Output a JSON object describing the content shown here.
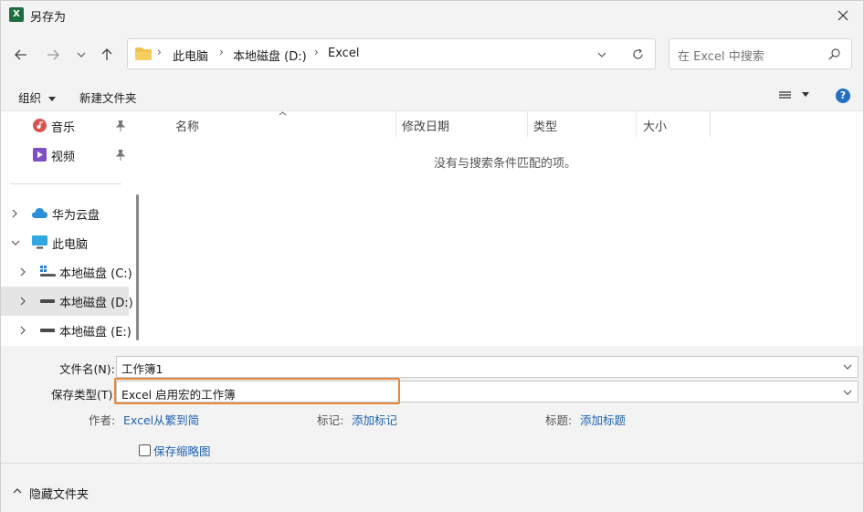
{
  "window": {
    "title": "另存为",
    "app_icon_letter": "X"
  },
  "nav": {
    "breadcrumb": [
      "此电脑",
      "本地磁盘 (D:)",
      "Excel"
    ],
    "search_placeholder": "在 Excel 中搜索"
  },
  "toolbar": {
    "organize": "组织",
    "new_folder": "新建文件夹",
    "help": "?"
  },
  "sidebar": {
    "items": [
      {
        "label": "音乐"
      },
      {
        "label": "视频"
      },
      {
        "label": "华为云盘"
      },
      {
        "label": "此电脑"
      },
      {
        "label": "本地磁盘 (C:)"
      },
      {
        "label": "本地磁盘 (D:)"
      },
      {
        "label": "本地磁盘 (E:)"
      }
    ]
  },
  "filelist": {
    "columns": [
      "名称",
      "修改日期",
      "类型",
      "大小"
    ],
    "empty_message": "没有与搜索条件匹配的项。"
  },
  "form": {
    "filename_label": "文件名(N):",
    "filename_value": "工作簿1",
    "filetype_label": "保存类型(T):",
    "filetype_value": "Excel 启用宏的工作簿",
    "author_label": "作者:",
    "author_value": "Excel从繁到简",
    "tags_label": "标记:",
    "tags_value": "添加标记",
    "title_label": "标题:",
    "title_value": "添加标题",
    "thumbnail_label": "保存缩略图"
  },
  "footer": {
    "hide_folders": "隐藏文件夹"
  },
  "colors": {
    "accent_link": "#1f63b0",
    "focus_ring": "#e6883a",
    "excel_green": "#1d6f42"
  }
}
